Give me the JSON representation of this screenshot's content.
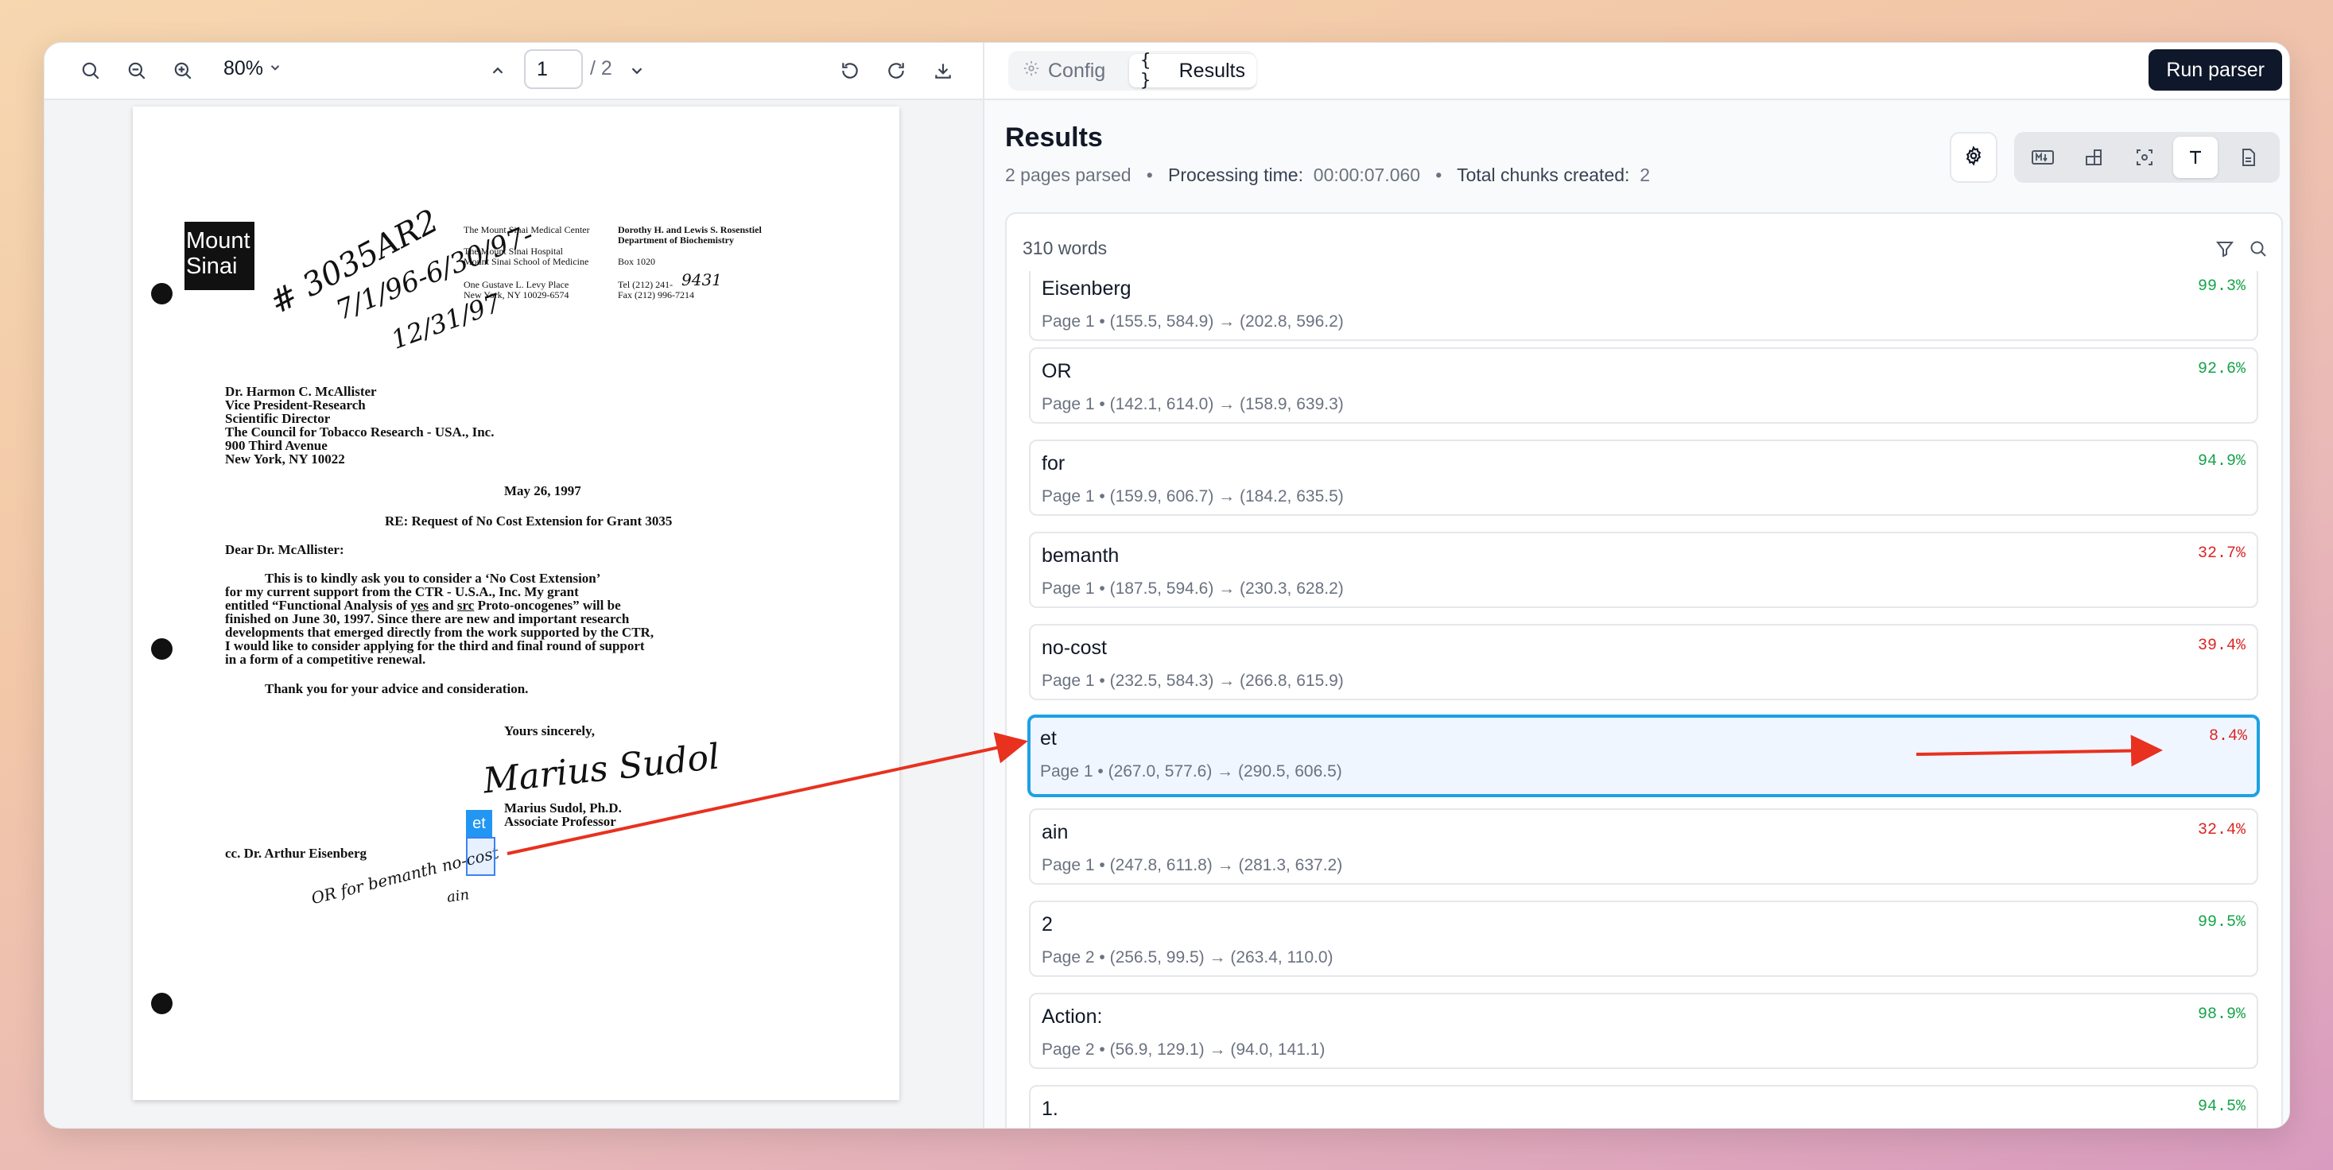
{
  "colors": {
    "accent": "#1ea1e4",
    "high_conf": "#16a34a",
    "low_conf": "#dc2626",
    "arrow": "#e8311f",
    "run_bg": "#0f172a"
  },
  "toolbar": {
    "zoom": "80%",
    "page_value": "1",
    "page_total": "/ 2"
  },
  "tabs": {
    "config": "Config",
    "results": "Results"
  },
  "run_button": "Run parser",
  "results": {
    "title": "Results",
    "pages_parsed": "2 pages parsed",
    "processing_label": "Processing time:",
    "processing_value": "00:00:07.060",
    "chunks_label": "Total chunks created:",
    "chunks_value": "2",
    "word_count": "310 words"
  },
  "items": [
    {
      "word": "Eisenberg",
      "meta": "Page 1  •  (155.5, 584.9) → (202.8, 596.2)",
      "conf": "99.3%",
      "level": "high"
    },
    {
      "word": "OR",
      "meta": "Page 1  •  (142.1, 614.0) → (158.9, 639.3)",
      "conf": "92.6%",
      "level": "high"
    },
    {
      "word": "for",
      "meta": "Page 1  •  (159.9, 606.7) → (184.2, 635.5)",
      "conf": "94.9%",
      "level": "high"
    },
    {
      "word": "bemanth",
      "meta": "Page 1  •  (187.5, 594.6) → (230.3, 628.2)",
      "conf": "32.7%",
      "level": "low"
    },
    {
      "word": "no-cost",
      "meta": "Page 1  •  (232.5, 584.3) → (266.8, 615.9)",
      "conf": "39.4%",
      "level": "low"
    },
    {
      "word": "et",
      "meta": "Page 1  •  (267.0, 577.6) → (290.5, 606.5)",
      "conf": "8.4%",
      "level": "low",
      "selected": true
    },
    {
      "word": "ain",
      "meta": "Page 1  •  (247.8, 611.8) → (281.3, 637.2)",
      "conf": "32.4%",
      "level": "low"
    },
    {
      "word": "2",
      "meta": "Page 2  •  (256.5, 99.5) → (263.4, 110.0)",
      "conf": "99.5%",
      "level": "high"
    },
    {
      "word": "Action:",
      "meta": "Page 2  •  (56.9, 129.1) → (94.0, 141.1)",
      "conf": "98.9%",
      "level": "high"
    },
    {
      "word": "1.",
      "meta": "",
      "conf": "94.5%",
      "level": "high"
    }
  ],
  "document": {
    "logo_line1": "Mount",
    "logo_line2": "Sinai",
    "hand_ref1": "# 3035AR2",
    "hand_ref2": "7/1/96-6/30/97-",
    "hand_ref3": "12/31/97",
    "inst1": "The Mount Sinai Medical Center",
    "inst2": "The Mount Sinai Hospital",
    "inst3": "Mount Sinai School of Medicine",
    "inst4": "One Gustave L. Levy Place",
    "inst5": "New York, NY 10029-6574",
    "dept1": "Dorothy H. and Lewis S. Rosenstiel",
    "dept2": "Department of Biochemistry",
    "box": "Box  1020",
    "tel": "Tel  (212) 241-",
    "tel_hand": "9431",
    "fax": "Fax (212) 996-7214",
    "addr1": "Dr. Harmon C. McAllister",
    "addr2": "Vice  President-Research",
    "addr3": "Scientific  Director",
    "addr4": "The Council for Tobacco Research - USA., Inc.",
    "addr5": "900 Third Avenue",
    "addr6": "New York,  NY  10022",
    "date": "May  26,  1997",
    "re": "RE: Request of No Cost Extension for Grant 3035",
    "salutation": "Dear Dr. McAllister:",
    "body1": "This is to kindly ask you to consider a ‘No Cost Extension’",
    "body2": "for my current support from the CTR - U.S.A., Inc.  My grant",
    "body3a": "entitled “Functional Analysis of ",
    "body3b": "yes",
    "body3c": " and ",
    "body3d": "src",
    "body3e": " Proto-oncogenes” will be",
    "body4": "finished on June 30, 1997.  Since there are new and important research",
    "body5": "developments that emerged directly from the work supported by the CTR,",
    "body6": "I would like to consider applying for the third and final round of support",
    "body7": "in a form of a competitive renewal.",
    "thanks": "Thank you for your advice and consideration.",
    "closing": "Yours  sincerely,",
    "signature": "Marius Sudol",
    "sig_name": "Marius Sudol, Ph.D.",
    "sig_title": "Associate  Professor",
    "cc": "cc. Dr. Arthur Eisenberg",
    "hand_note": "OR for bemanth no-cost",
    "hand_note2": "ain",
    "highlight_tag": "et"
  }
}
